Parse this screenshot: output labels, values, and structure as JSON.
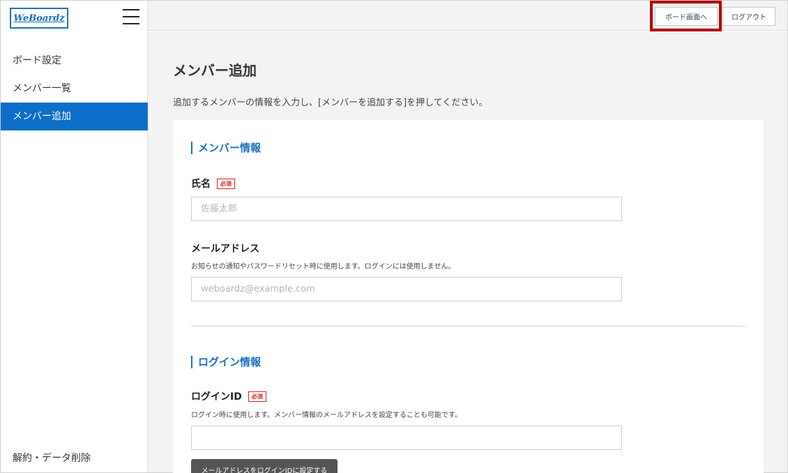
{
  "sidebar": {
    "logo": "WeBoardz",
    "items": [
      {
        "label": "ボード設定"
      },
      {
        "label": "メンバー一覧"
      },
      {
        "label": "メンバー追加"
      }
    ],
    "bottom_item": "解約・データ削除"
  },
  "topbar": {
    "board_button": "ボード画面へ",
    "logout_button": "ログアウト"
  },
  "main": {
    "title": "メンバー追加",
    "description": "追加するメンバーの情報を入力し、[メンバーを追加する]を押してください。",
    "sections": {
      "member_info": {
        "title": "メンバー情報",
        "name_label": "氏名",
        "required_badge": "必須",
        "name_placeholder": "佐藤太郎",
        "email_label": "メールアドレス",
        "email_note": "お知らせの通知やパスワードリセット時に使用します。ログインには使用しません。",
        "email_placeholder": "weboardz@example.com"
      },
      "login_info": {
        "title": "ログイン情報",
        "login_id_label": "ログインID",
        "required_badge": "必須",
        "login_id_note": "ログイン時に使用します。メンバー情報のメールアドレスを設定することも可能です。",
        "login_id_value": "",
        "set_email_button": "メールアドレスをログインIDに設定する"
      }
    }
  },
  "colors": {
    "accent": "#0d6fc9",
    "required": "#d12222",
    "highlight_box": "#b30000"
  },
  "icons": {
    "menu": "hamburger-icon"
  }
}
